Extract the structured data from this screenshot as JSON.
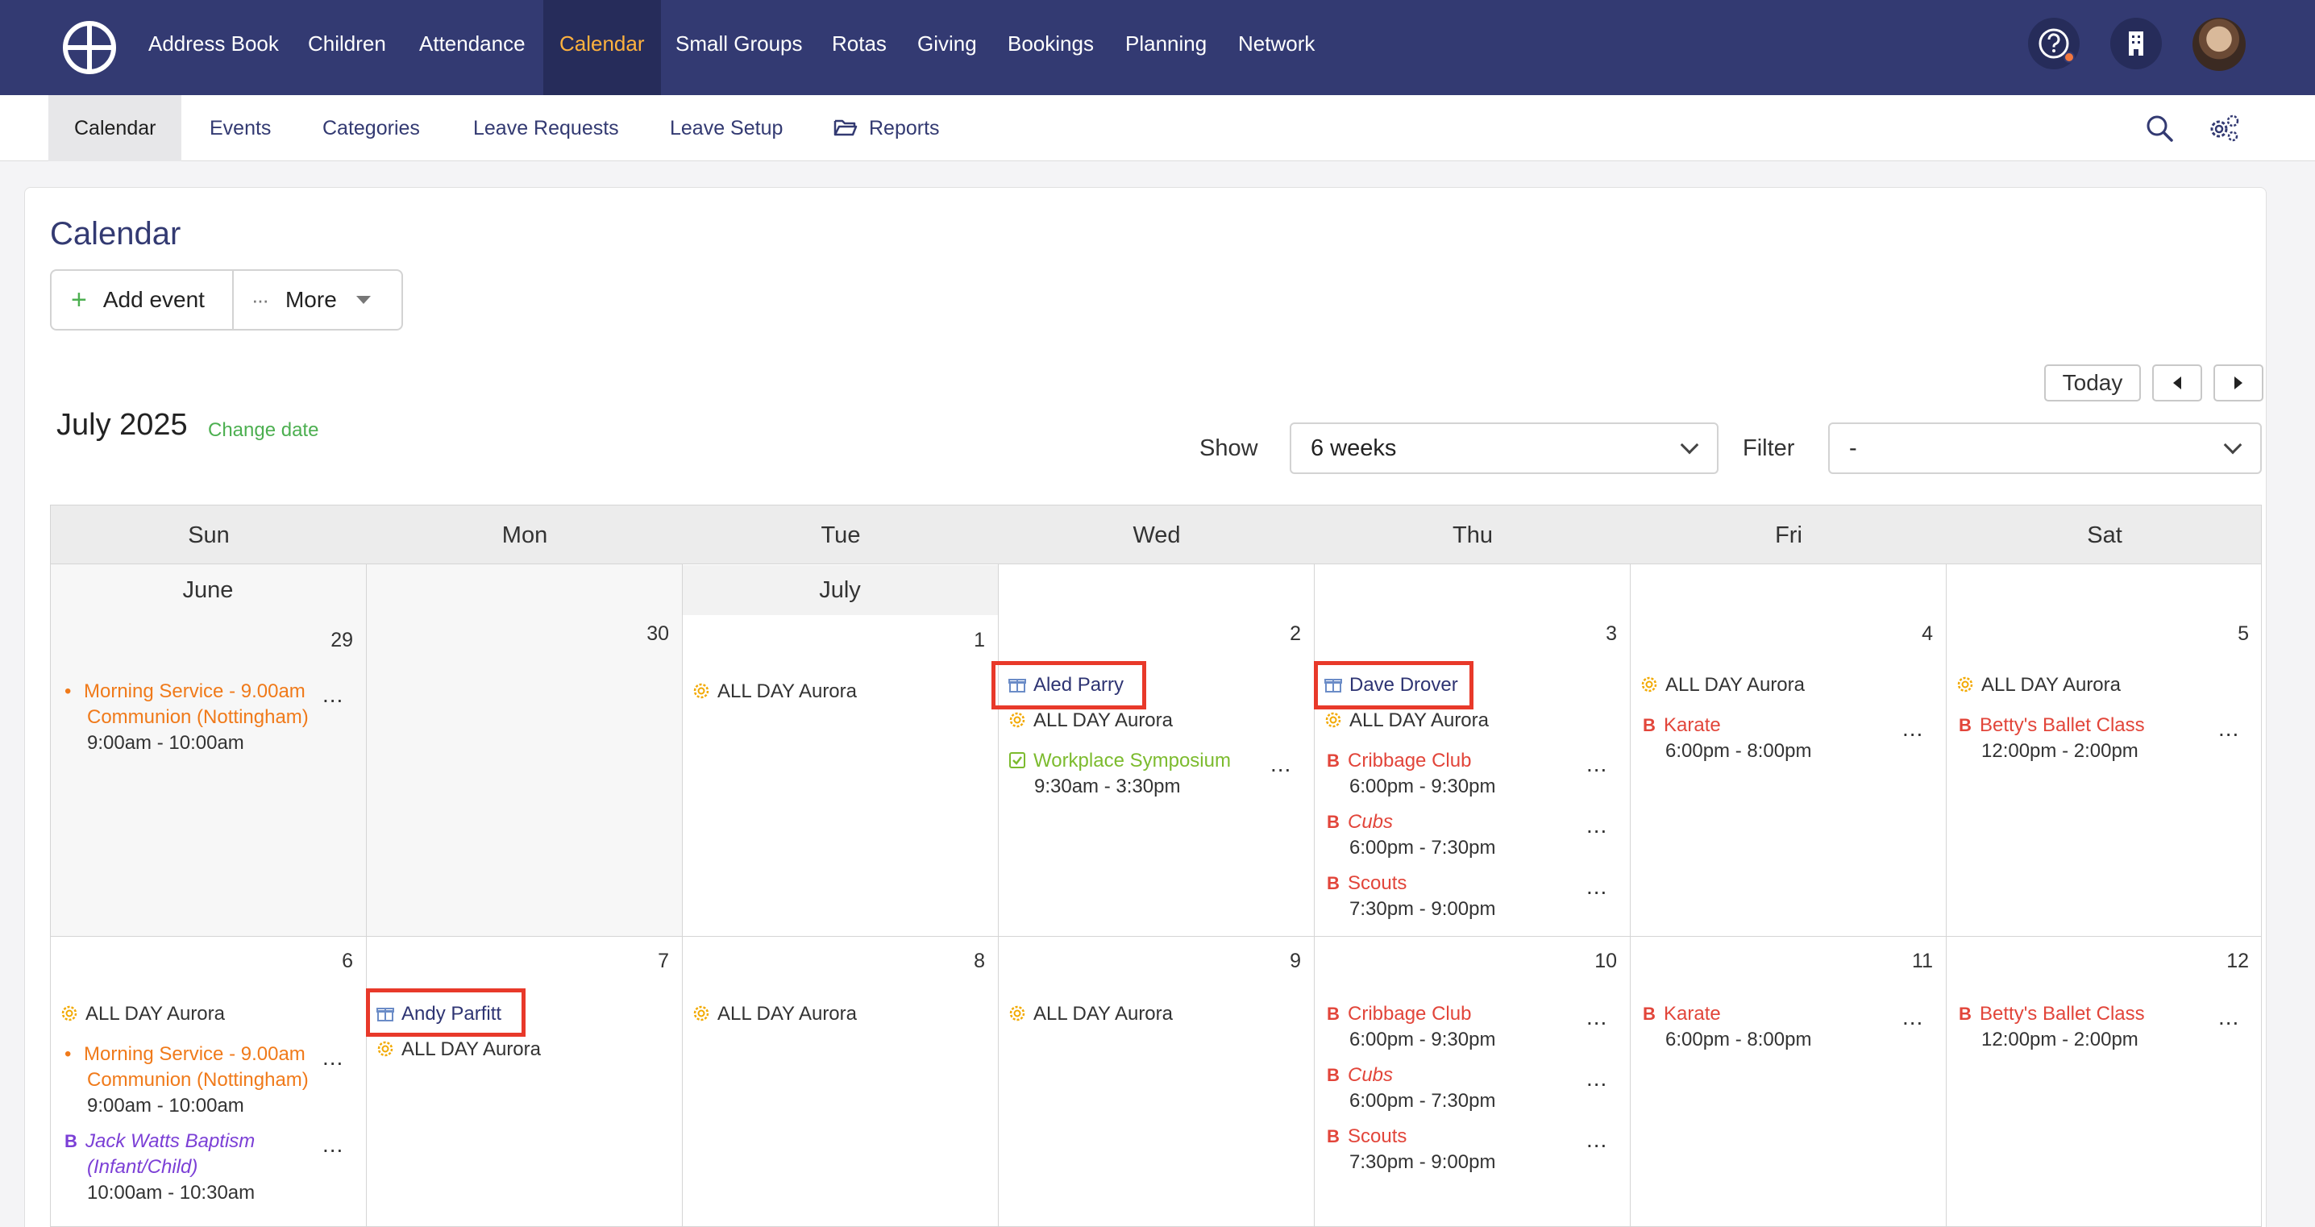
{
  "topnav": {
    "items": [
      "Address Book",
      "Children",
      "Attendance",
      "Calendar",
      "Small Groups",
      "Rotas",
      "Giving",
      "Bookings",
      "Planning",
      "Network"
    ],
    "active": "Calendar"
  },
  "subnav": {
    "items": [
      "Calendar",
      "Events",
      "Categories",
      "Leave Requests",
      "Leave Setup",
      "Reports"
    ],
    "active": "Calendar"
  },
  "page": {
    "title": "Calendar",
    "add_event": "Add event",
    "more": "More",
    "today": "Today",
    "month_title": "July 2025",
    "change_date": "Change date",
    "show_label": "Show",
    "show_value": "6 weeks",
    "filter_label": "Filter",
    "filter_value": "-"
  },
  "calendar": {
    "days_of_week": [
      "Sun",
      "Mon",
      "Tue",
      "Wed",
      "Thu",
      "Fri",
      "Sat"
    ],
    "month_bands": {
      "june": "June",
      "july": "July"
    },
    "week1": {
      "d0": {
        "num": "29",
        "e1": "Morning Service - 9.00am",
        "e1b": "Communion (Nottingham)",
        "e1t": "9:00am - 10:00am"
      },
      "d1": {
        "num": "30"
      },
      "d2": {
        "num": "1",
        "e1": "ALL DAY Aurora"
      },
      "d3": {
        "num": "2",
        "bday": "Aled Parry",
        "e1": "ALL DAY Aurora",
        "e2": "Workplace Symposium",
        "e2t": "9:30am - 3:30pm"
      },
      "d4": {
        "num": "3",
        "bday": "Dave Drover",
        "e1": "ALL DAY Aurora",
        "e2": "Cribbage Club",
        "e2t": "6:00pm - 9:30pm",
        "e3": "Cubs",
        "e3t": "6:00pm - 7:30pm",
        "e4": "Scouts",
        "e4t": "7:30pm - 9:00pm"
      },
      "d5": {
        "num": "4",
        "e1": "ALL DAY Aurora",
        "e2": "Karate",
        "e2t": "6:00pm - 8:00pm"
      },
      "d6": {
        "num": "5",
        "e1": "ALL DAY Aurora",
        "e2": "Betty's Ballet Class",
        "e2t": "12:00pm - 2:00pm"
      }
    },
    "week2": {
      "d0": {
        "num": "6",
        "e1": "ALL DAY Aurora",
        "e2": "Morning Service - 9.00am",
        "e2b": "Communion (Nottingham)",
        "e2t": "9:00am - 10:00am",
        "e3": "Jack Watts Baptism",
        "e3b": "(Infant/Child)",
        "e3t": "10:00am - 10:30am"
      },
      "d1": {
        "num": "7",
        "bday": "Andy Parfitt",
        "e1": "ALL DAY Aurora"
      },
      "d2": {
        "num": "8",
        "e1": "ALL DAY Aurora"
      },
      "d3": {
        "num": "9",
        "e1": "ALL DAY Aurora"
      },
      "d4": {
        "num": "10",
        "e1": "Cribbage Club",
        "e1t": "6:00pm - 9:30pm",
        "e2": "Cubs",
        "e2t": "6:00pm - 7:30pm",
        "e3": "Scouts",
        "e3t": "7:30pm - 9:00pm"
      },
      "d5": {
        "num": "11",
        "e1": "Karate",
        "e1t": "6:00pm - 8:00pm"
      },
      "d6": {
        "num": "12",
        "e1": "Betty's Ballet Class",
        "e1t": "12:00pm - 2:00pm"
      }
    },
    "more_label": "..."
  },
  "colors": {
    "nav_bg": "#333a72",
    "nav_active": "#ffb23e",
    "highlight": "#e8392a",
    "service": "#f07a1a",
    "booking": "#e2453a",
    "symposium": "#7cbb2e",
    "baptism": "#7b3fd6"
  }
}
